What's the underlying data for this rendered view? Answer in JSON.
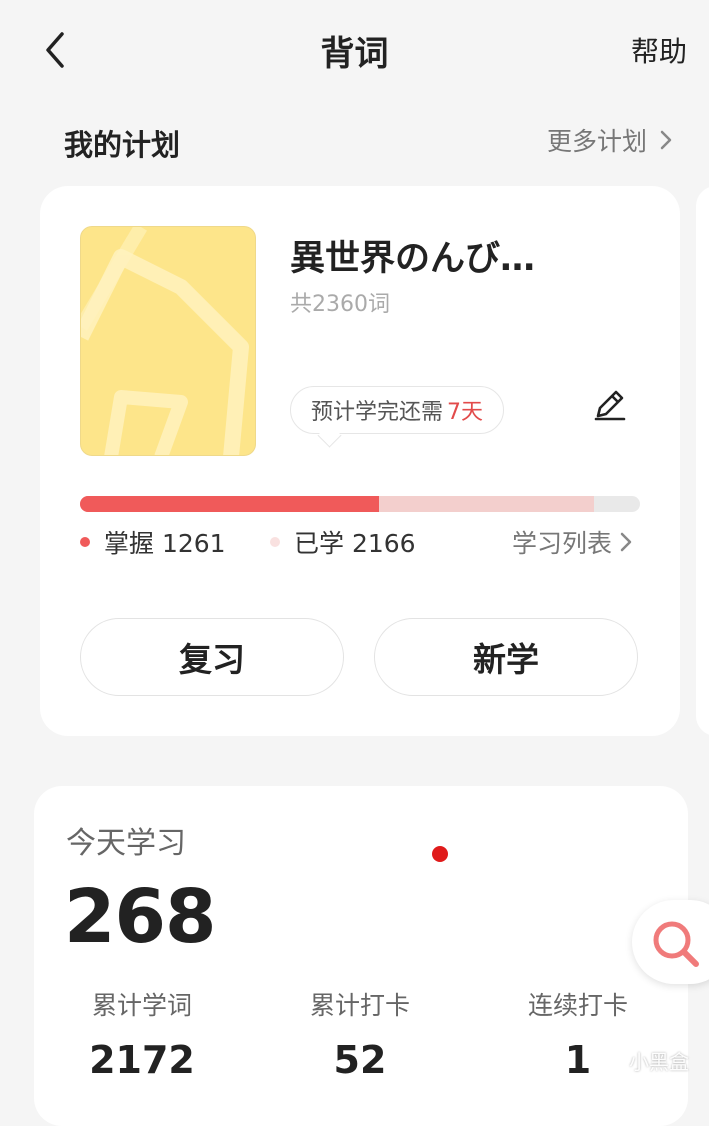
{
  "header": {
    "title": "背词",
    "help_label": "帮助"
  },
  "plans": {
    "section_title": "我的计划",
    "more_label": "更多计划"
  },
  "plan": {
    "book_title": "異世界のんび…",
    "word_count_label": "共2360词",
    "eta_prefix": "预计学完还需",
    "eta_days": "7天",
    "total_words": 2360,
    "mastered_label": "掌握 1261",
    "learned_label": "已学 2166",
    "mastered": 1261,
    "learned": 2166,
    "study_list_label": "学习列表",
    "review_button": "复习",
    "new_button": "新学"
  },
  "today": {
    "label": "今天学习",
    "count": "268",
    "stats": [
      {
        "label": "累计学词",
        "value": "2172"
      },
      {
        "label": "累计打卡",
        "value": "52"
      },
      {
        "label": "连续打卡",
        "value": "1"
      }
    ]
  },
  "watermark": {
    "text": "小黑盒"
  },
  "colors": {
    "accent": "#f05a5a",
    "accent_light": "#f3cfcd",
    "eta_days": "#e24b4b",
    "cover": "#fde58a",
    "red_dot": "#e01b1b"
  },
  "icons": [
    "back-arrow-icon",
    "chevron-right-icon",
    "edit-pencil-icon",
    "search-icon"
  ]
}
